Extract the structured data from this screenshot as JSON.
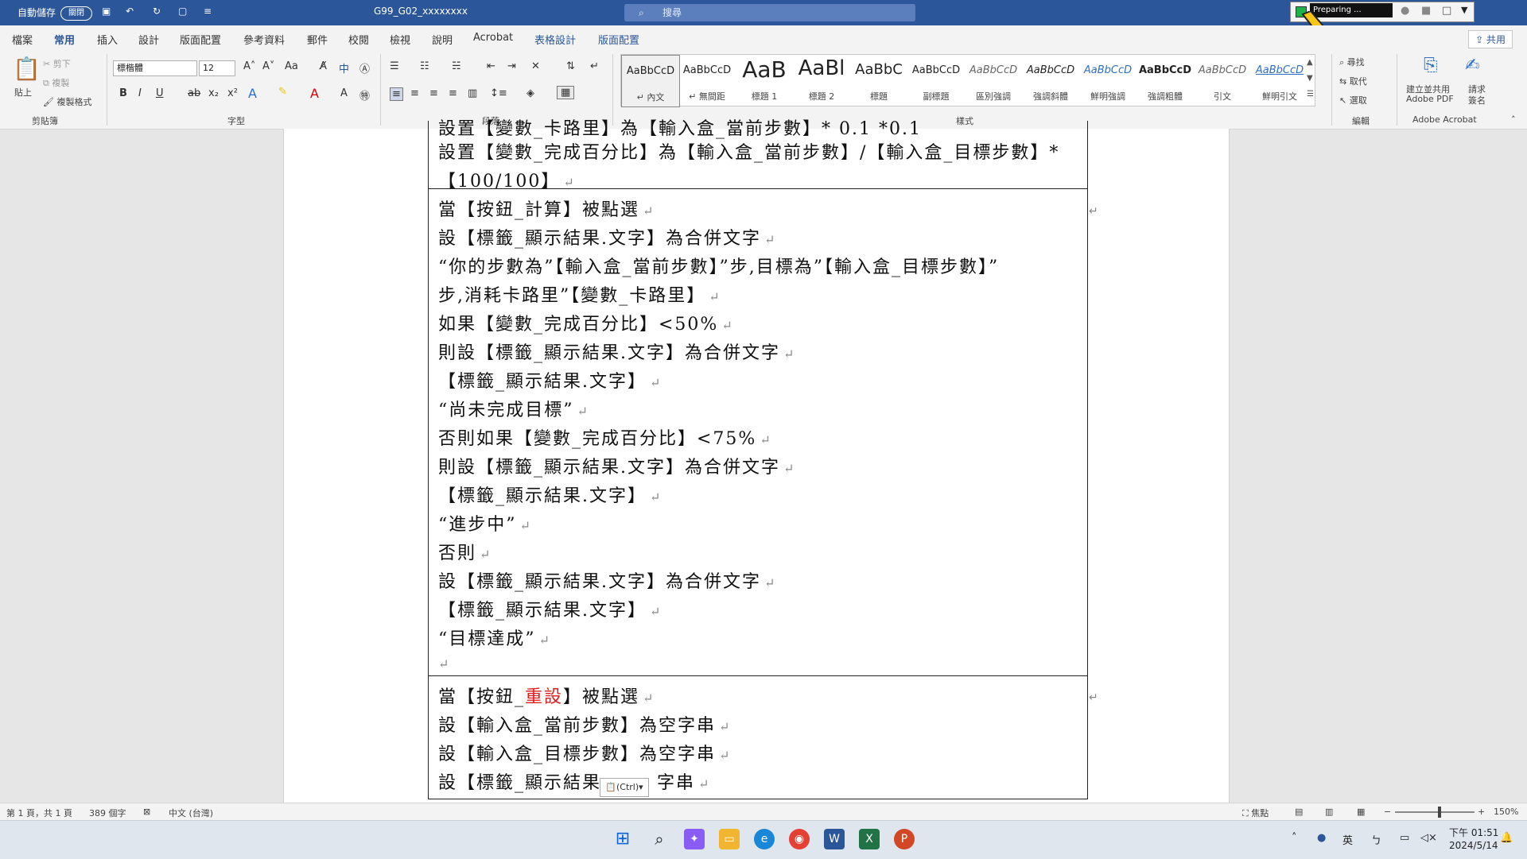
{
  "titlebar": {
    "autosave_label": "自動儲存",
    "autosave_state": "關閉",
    "filename": "G99_G02_xxxxxxxx",
    "search_placeholder": "搜尋",
    "recorder_status": "Preparing ..."
  },
  "tabs": [
    {
      "label": "檔案"
    },
    {
      "label": "常用"
    },
    {
      "label": "插入"
    },
    {
      "label": "設計"
    },
    {
      "label": "版面配置"
    },
    {
      "label": "參考資料"
    },
    {
      "label": "郵件"
    },
    {
      "label": "校閱"
    },
    {
      "label": "檢視"
    },
    {
      "label": "說明"
    },
    {
      "label": "Acrobat"
    },
    {
      "label": "表格設計"
    },
    {
      "label": "版面配置"
    }
  ],
  "share_label": "共用",
  "ribbon": {
    "clipboard": {
      "paste": "貼上",
      "cut": "剪下",
      "copy": "複製",
      "format_painter": "複製格式",
      "group": "剪貼簿"
    },
    "font": {
      "name": "標楷體",
      "size": "12",
      "case": "Aa",
      "group": "字型"
    },
    "paragraph": {
      "group": "段落"
    },
    "styles": {
      "group": "樣式",
      "items": [
        {
          "preview": "AaBbCcD",
          "name": "↵ 內文"
        },
        {
          "preview": "AaBbCcD",
          "name": "↵ 無間距"
        },
        {
          "preview": "AaB",
          "name": "標題 1"
        },
        {
          "preview": "AaBl",
          "name": "標題 2"
        },
        {
          "preview": "AaBbC",
          "name": "標題"
        },
        {
          "preview": "AaBbCcD",
          "name": "副標題"
        },
        {
          "preview": "AaBbCcD",
          "name": "區別強調"
        },
        {
          "preview": "AaBbCcD",
          "name": "強調斜體"
        },
        {
          "preview": "AaBbCcD",
          "name": "鮮明強調"
        },
        {
          "preview": "AaBbCcD",
          "name": "強調粗體"
        },
        {
          "preview": "AaBbCcD",
          "name": "引文"
        },
        {
          "preview": "AaBbCcD",
          "name": "鮮明引文"
        }
      ]
    },
    "editing": {
      "find": "尋找",
      "replace": "取代",
      "select": "選取",
      "group": "編輯"
    },
    "acrobat": {
      "create_pdf_line1": "建立並共用",
      "create_pdf_line2": "Adobe PDF",
      "sign_line1": "請求",
      "sign_line2": "簽名",
      "group": "Adobe Acrobat"
    }
  },
  "document": {
    "lines": [
      "設置【變數_卡路里】為【輸入盒_當前步數】* 0.1 *0.1",
      "設置【變數_完成百分比】為【輸入盒_當前步數】/【輸入盒_目標步數】*",
      "【100/100】",
      "當【按鈕_計算】被點選",
      "設【標籤_顯示結果.文字】為合併文字",
      "“你的步數為”【輸入盒_當前步數】”步,目標為”【輸入盒_目標步數】”",
      "步,消耗卡路里”【變數_卡路里】",
      "如果【變數_完成百分比】<50%",
      "則設【標籤_顯示結果.文字】為合併文字",
      "【標籤_顯示結果.文字】",
      "“尚未完成目標”",
      "否則如果【變數_完成百分比】<75%",
      "則設【標籤_顯示結果.文字】為合併文字",
      "【標籤_顯示結果.文字】",
      "“進步中”",
      "否則",
      "設【標籤_顯示結果.文字】為合併文字",
      "【標籤_顯示結果.文字】",
      "“目標達成”",
      "",
      "當【按鈕_",
      "重設",
      "】被點選",
      "設【輸入盒_當前步數】為空字串",
      "設【輸入盒_目標步數】為空字串",
      "設【標籤_顯示結果",
      "字串"
    ],
    "paste_options": "(Ctrl)"
  },
  "statusbar": {
    "page": "第 1 頁，共 1 頁",
    "words": "389 個字",
    "language": "中文 (台灣)",
    "focus": "焦點",
    "zoom": "150%"
  },
  "taskbar": {
    "ime": "英",
    "time": "下午 01:51",
    "date": "2024/5/14"
  }
}
